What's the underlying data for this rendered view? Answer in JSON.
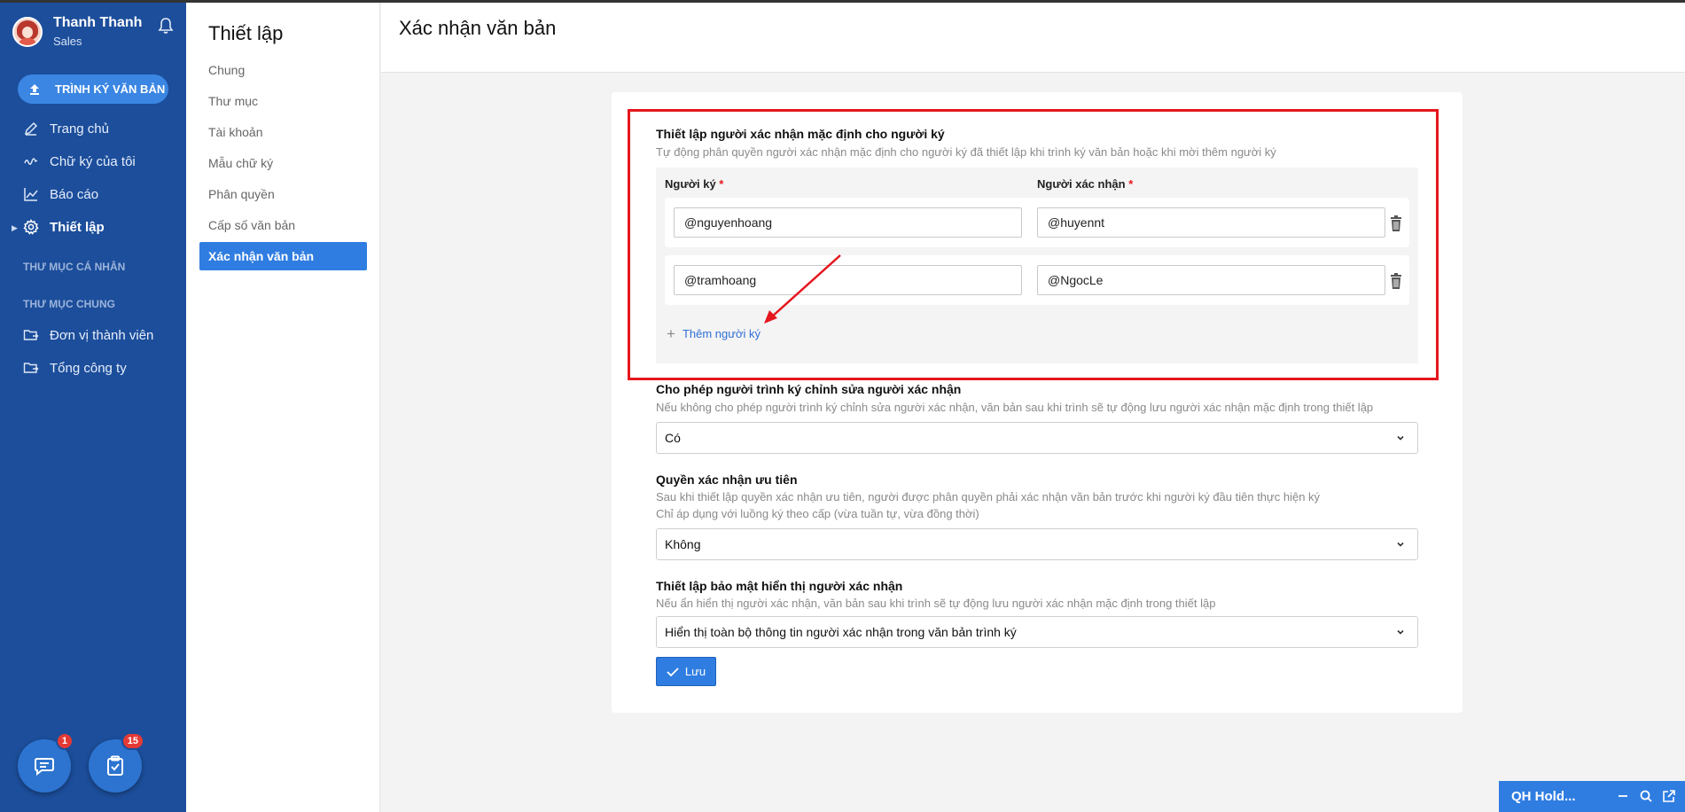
{
  "user": {
    "name": "Thanh Thanh ...",
    "role": "Sales"
  },
  "sidebar": {
    "sign_button": "TRÌNH KÝ VĂN BẢN",
    "items": [
      {
        "label": "Trang chủ",
        "icon": "pen-icon"
      },
      {
        "label": "Chữ ký của tôi",
        "icon": "signature-icon"
      },
      {
        "label": "Báo cáo",
        "icon": "chart-line-icon"
      },
      {
        "label": "Thiết lập",
        "icon": "gear-icon"
      }
    ],
    "section_personal": "THƯ MỤC CÁ NHÂN",
    "section_shared": "THƯ MỤC CHUNG",
    "folders": [
      {
        "label": "Đơn vị thành viên",
        "icon": "folder-share-icon"
      },
      {
        "label": "Tổng công ty",
        "icon": "folder-share-icon"
      }
    ],
    "chat_badge": "1",
    "task_badge": "15"
  },
  "settings_menu": {
    "title": "Thiết lập",
    "items": [
      "Chung",
      "Thư mục",
      "Tài khoản",
      "Mẫu chữ ký",
      "Phân quyền",
      "Cấp số văn bản",
      "Xác nhận văn bản"
    ]
  },
  "page": {
    "title": "Xác nhận văn bản",
    "section1": {
      "title": "Thiết lập người xác nhận mặc định cho người ký",
      "desc": "Tự động phân quyền người xác nhận mặc định cho người ký đã thiết lập khi trình ký văn bản hoặc khi mời thêm người ký",
      "col_signer": "Người ký",
      "col_confirmer": "Người xác nhận",
      "required_mark": "*",
      "rows": [
        {
          "signer": "@nguyenhoang",
          "confirmer": "@huyennt"
        },
        {
          "signer": "@tramhoang",
          "confirmer": "@NgocLe"
        }
      ],
      "add_label": "Thêm người ký"
    },
    "section2": {
      "title": "Cho phép người trình ký chỉnh sửa người xác nhận",
      "desc": "Nếu không cho phép người trình ký chỉnh sửa người xác nhận, văn bản sau khi trình sẽ tự động lưu người xác nhận mặc định trong thiết lập",
      "value": "Có"
    },
    "section3": {
      "title": "Quyền xác nhận ưu tiên",
      "desc1": "Sau khi thiết lập quyền xác nhận ưu tiên, người được phân quyền phải xác nhận văn bản trước khi người ký đầu tiên thực hiện ký",
      "desc2": "Chỉ áp dụng với luồng ký theo cấp (vừa tuần tự, vừa đồng thời)",
      "value": "Không"
    },
    "section4": {
      "title": "Thiết lập bảo mật hiển thị người xác nhận",
      "desc": "Nếu ẩn hiển thị người xác nhận, văn bản sau khi trình sẽ tự động lưu người xác nhận mặc định trong thiết lập",
      "value": "Hiển thị toàn bộ thông tin người xác nhận trong văn bản trình ký"
    },
    "save_label": "Lưu"
  },
  "widget": {
    "title": "QH Hold..."
  },
  "colors": {
    "sidebar": "#1c4e9b",
    "accent": "#2f7de1",
    "highlight": "#e5161e"
  }
}
